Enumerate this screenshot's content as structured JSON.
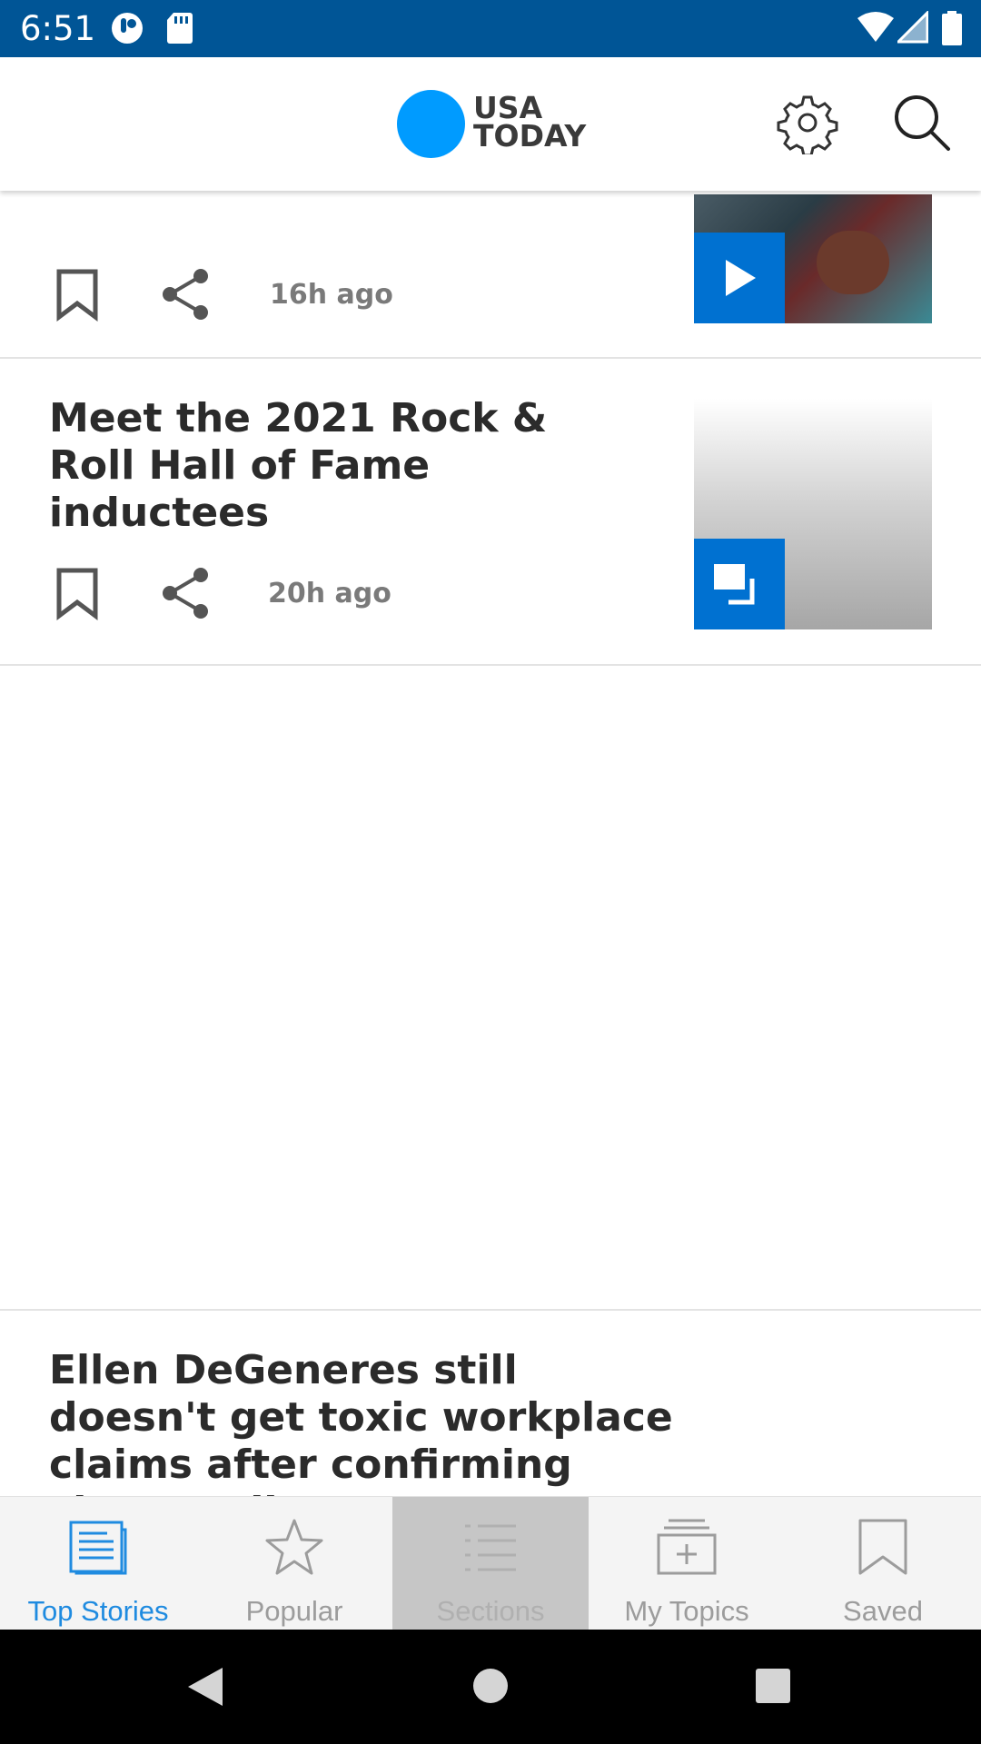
{
  "status_bar": {
    "time": "6:51"
  },
  "header": {
    "logo_line1": "USA",
    "logo_line2": "TODAY"
  },
  "colors": {
    "status_bar": "#005596",
    "brand": "#009bff",
    "badge": "#0071d1",
    "active_nav": "#1f8be0"
  },
  "feed": {
    "cards": [
      {
        "time_ago": "16h ago",
        "media_type": "video"
      },
      {
        "headline": "Meet the 2021 Rock & Roll Hall of Fame inductees",
        "time_ago": "20h ago",
        "media_type": "gallery"
      },
      {
        "headline": "Ellen DeGeneres still doesn't get toxic workplace claims after confirming show ending"
      }
    ]
  },
  "bottom_nav": {
    "items": [
      {
        "label": "Top Stories",
        "icon": "newspaper-icon",
        "state": "active"
      },
      {
        "label": "Popular",
        "icon": "star-icon",
        "state": "normal"
      },
      {
        "label": "Sections",
        "icon": "list-icon",
        "state": "pressed"
      },
      {
        "label": "My Topics",
        "icon": "add-topic-icon",
        "state": "normal"
      },
      {
        "label": "Saved",
        "icon": "bookmark-icon",
        "state": "normal"
      }
    ]
  }
}
